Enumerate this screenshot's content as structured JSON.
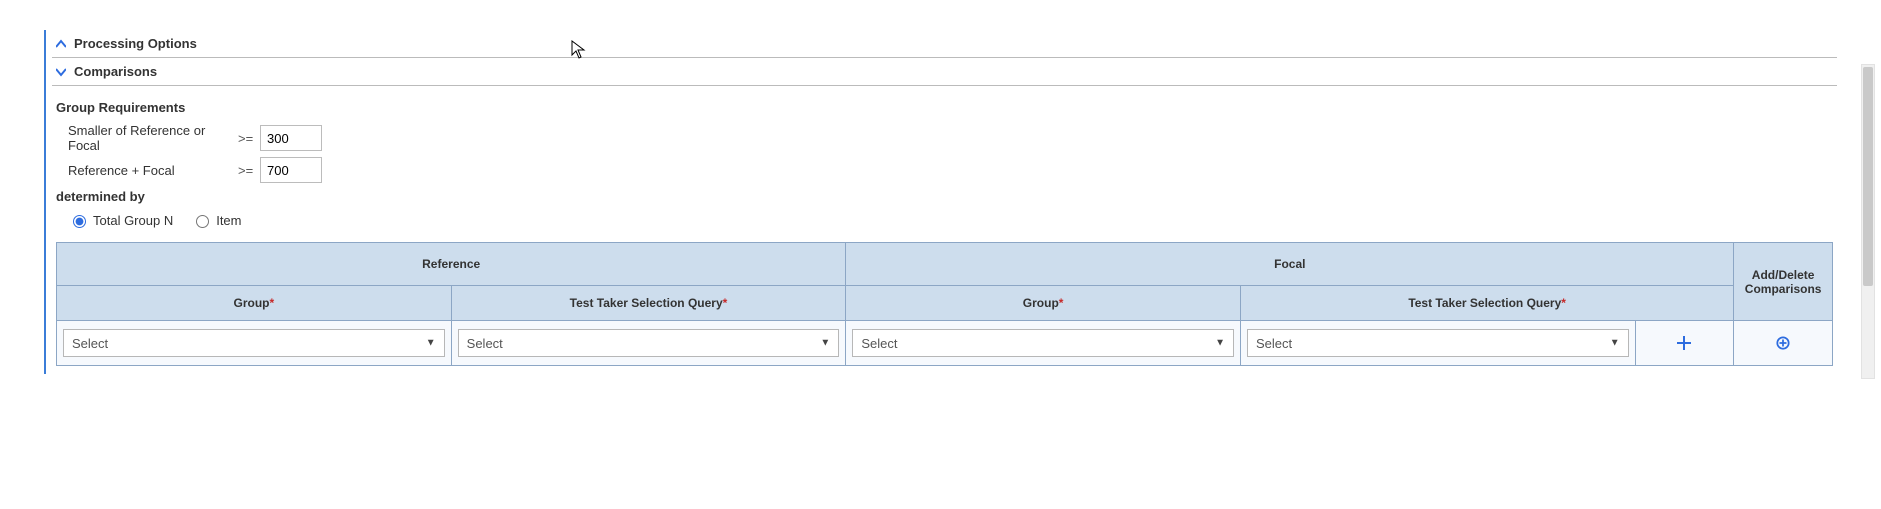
{
  "sections": {
    "processing_options": {
      "title": "Processing Options",
      "expanded": false
    },
    "comparisons": {
      "title": "Comparisons",
      "expanded": true
    }
  },
  "group_requirements": {
    "heading": "Group Requirements",
    "rows": [
      {
        "label": "Smaller of Reference or Focal",
        "operator": ">=",
        "value": "300"
      },
      {
        "label": "Reference + Focal",
        "operator": ">=",
        "value": "700"
      }
    ]
  },
  "determined_by": {
    "heading": "determined by",
    "options": [
      {
        "label": "Total Group N",
        "value": "total",
        "checked": true
      },
      {
        "label": "Item",
        "value": "item",
        "checked": false
      }
    ]
  },
  "table": {
    "headers": {
      "reference": "Reference",
      "focal": "Focal",
      "add_delete": "Add/Delete Comparisons",
      "group": "Group",
      "tts_query": "Test Taker Selection Query",
      "required_mark": "*"
    },
    "select_placeholder": "Select",
    "rows": [
      {
        "ref_group": "Select",
        "ref_query": "Select",
        "focal_group": "Select",
        "focal_query": "Select"
      }
    ]
  }
}
